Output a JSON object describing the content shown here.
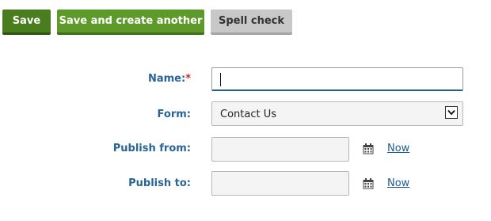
{
  "toolbar": {
    "save_label": "Save",
    "save_another_label": "Save and create another",
    "spell_label": "Spell check"
  },
  "form": {
    "name_label": "Name:",
    "required_mark": "*",
    "name_value": "",
    "form_label": "Form:",
    "form_selected": "Contact Us",
    "publish_from_label": "Publish from:",
    "publish_from_value": "",
    "publish_from_now": "Now",
    "publish_to_label": "Publish to:",
    "publish_to_value": "",
    "publish_to_now": "Now"
  },
  "icons": {
    "calendar": "calendar-icon",
    "dropdown": "chevron-down-icon"
  },
  "colors": {
    "save": "#497d1e",
    "save_another": "#5e9a2a",
    "spell": "#c8c8c8",
    "label": "#2a6496",
    "required": "#d2232a",
    "link": "#1c5c96"
  }
}
